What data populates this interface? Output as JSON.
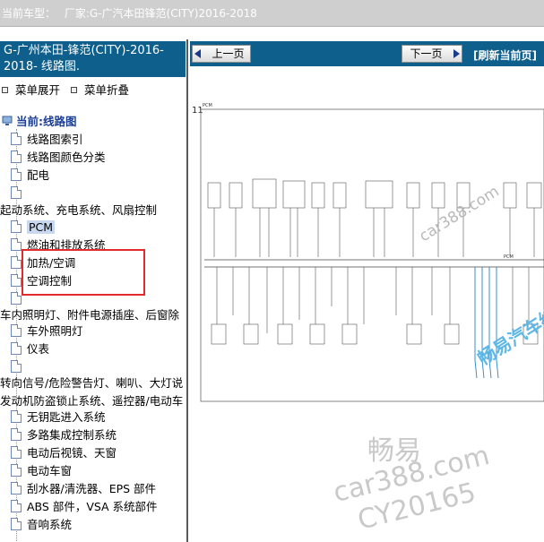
{
  "topbar": {
    "label": "当前车型：",
    "value": "厂家:G-广汽本田锋范(CITY)2016-2018"
  },
  "left": {
    "title": "G-广州本田-锋范(CITY)-2016-2018- 线路图.",
    "expand_label": "菜单展开",
    "collapse_label": "菜单折叠",
    "current_label": "当前:线路图",
    "items": [
      {
        "label": "线路图索引"
      },
      {
        "label": "线路图颜色分类"
      },
      {
        "label": "配电"
      },
      {
        "label": ""
      },
      {
        "label": "起动系统、充电系统、风扇控制"
      },
      {
        "label": "PCM"
      },
      {
        "label": "燃油和排放系统"
      },
      {
        "label": "加热/空调"
      },
      {
        "label": "空调控制"
      },
      {
        "label": ""
      },
      {
        "label": "车内照明灯、附件电源插座、后窗除"
      },
      {
        "label": "车外照明灯"
      },
      {
        "label": "仪表"
      },
      {
        "label": ""
      },
      {
        "label": "转向信号/危险警告灯、喇叭、大灯说"
      },
      {
        "label": "发动机防盗锁止系统、遥控器/电动车"
      },
      {
        "label": "无钥匙进入系统"
      },
      {
        "label": "多路集成控制系统"
      },
      {
        "label": "电动后视镜、天窗"
      },
      {
        "label": "电动车窗"
      },
      {
        "label": "刮水器/清洗器、EPS 部件"
      },
      {
        "label": "ABS 部件，VSA 系统部件"
      },
      {
        "label": "音响系统"
      }
    ]
  },
  "right": {
    "prev_label": "上一页",
    "next_label": "下一页",
    "refresh_label": "[刷新当前页]",
    "page_number": "11",
    "diagram_title": "PCM",
    "diagram_label": "PCM"
  },
  "watermarks": {
    "diag_site": "car388.com",
    "diag_brand": "畅易汽车维修平台",
    "brand": "畅易",
    "site": "car388.com",
    "code": "CY20165"
  },
  "colors": {
    "title_bar": "#0e5f8c",
    "highlight_box": "#e22b2b",
    "selected": "#c8d8ee"
  }
}
